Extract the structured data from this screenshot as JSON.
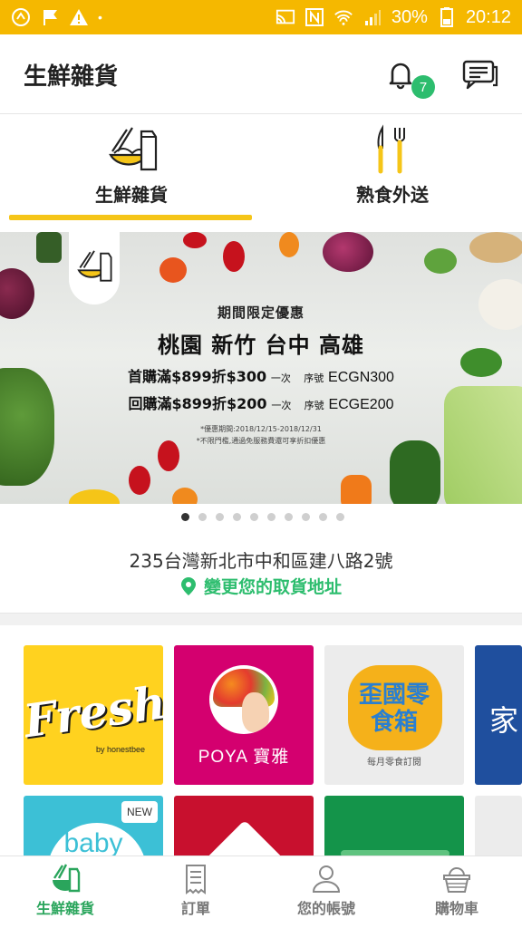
{
  "status_bar": {
    "battery": "30%",
    "time": "20:12"
  },
  "header": {
    "title": "生鮮雜貨",
    "notification_count": "7"
  },
  "category_tabs": [
    {
      "label": "生鮮雜貨"
    },
    {
      "label": "熟食外送"
    }
  ],
  "banner": {
    "promo_title": "期間限定優惠",
    "cities": "桃園 新竹 台中 高雄",
    "offer1_prefix": "首購",
    "offer1": "滿$899折$300",
    "offer1_once": "一次",
    "offer1_code_label": "序號",
    "offer1_code": "ECGN300",
    "offer2_prefix": "回購",
    "offer2": "滿$899折$200",
    "offer2_once": "一次",
    "offer2_code_label": "序號",
    "offer2_code": "ECGE200",
    "period": "*優惠期間:2018/12/15-2018/12/31",
    "note": "*不限門檻,通過免服務費還可享折扣優惠",
    "slide_count": 10,
    "active_slide": 1
  },
  "address": {
    "text": "235台灣新北市中和區建八路2號",
    "change_label": "變更您的取貨地址"
  },
  "stores_row1": [
    {
      "name": "Fresh",
      "sub": "by honestbee",
      "color": "#ffd21f"
    },
    {
      "name": "POYA 寶雅",
      "color": "#d4006f"
    },
    {
      "name": "歪國零食箱",
      "sub": "每月零食訂閱",
      "color": "#ececec"
    },
    {
      "name": "家",
      "color": "#1f4f9e"
    }
  ],
  "stores_row2": [
    {
      "name": "baby",
      "badge": "NEW",
      "color": "#3cc0d6"
    },
    {
      "name": "",
      "color": "#c8102e"
    },
    {
      "name": "",
      "color": "#14944a"
    },
    {
      "name": "",
      "color": "#ececec"
    }
  ],
  "bottom_nav": [
    {
      "label": "生鮮雜貨",
      "active": true
    },
    {
      "label": "訂單"
    },
    {
      "label": "您的帳號"
    },
    {
      "label": "購物車"
    }
  ],
  "colors": {
    "brand_yellow": "#f5c518",
    "status_bar": "#f5b800",
    "accent_green": "#2dbd6e"
  }
}
